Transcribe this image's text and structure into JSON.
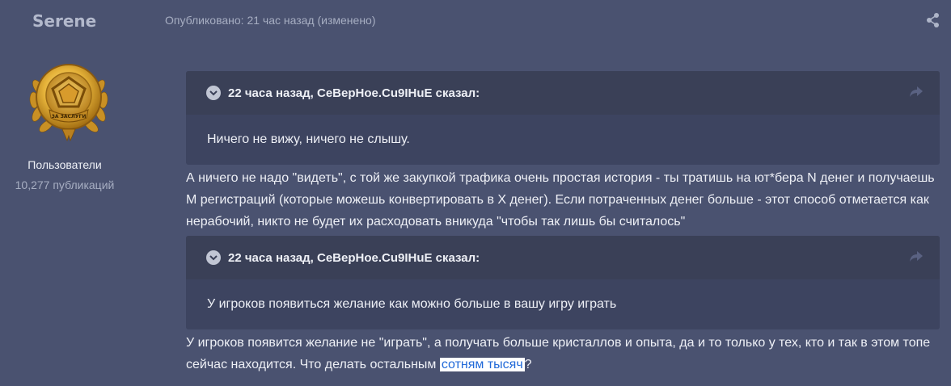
{
  "author": {
    "name": "Serene",
    "group": "Пользователи",
    "posts": "10,277 публикаций",
    "badge_text": "ЗА ЗАСЛУГИ"
  },
  "post": {
    "meta": "Опубликовано: 21 час назад (изменено)",
    "icons": {
      "share": "share-icon",
      "collapse": "chevron-down-icon",
      "jump": "reply-arrow-icon"
    },
    "quote1": {
      "citation": "22 часа назад, СеВерНое.Cu9IHuE сказал:",
      "text": "Ничего не вижу, ничего не слышу."
    },
    "reply1": "А ничего не надо \"видеть\", с той же закупкой трафика очень простая история - ты тратишь на ют*бера N денег и получаешь M регистраций (которые можешь конвертировать в X денег). Если потраченных денег больше - этот способ отметается как нерабочий, никто не будет их расходовать вникуда \"чтобы так лишь бы считалось\"",
    "quote2": {
      "citation": "22 часа назад, СеВерНое.Cu9IHuE сказал:",
      "text": "У игроков появиться желание как можно больше в вашу игру играть"
    },
    "reply2_before": "У игроков появится желание не \"играть\", а получать больше кристаллов и опыта, да и то только у тех, кто и так в этом топе сейчас находится. Что делать остальным ",
    "reply2_link": "сотням тысяч",
    "reply2_after": "?"
  },
  "colors": {
    "background": "#4a5270",
    "quote_bg": "#3d4460",
    "link": "#2169d8"
  }
}
